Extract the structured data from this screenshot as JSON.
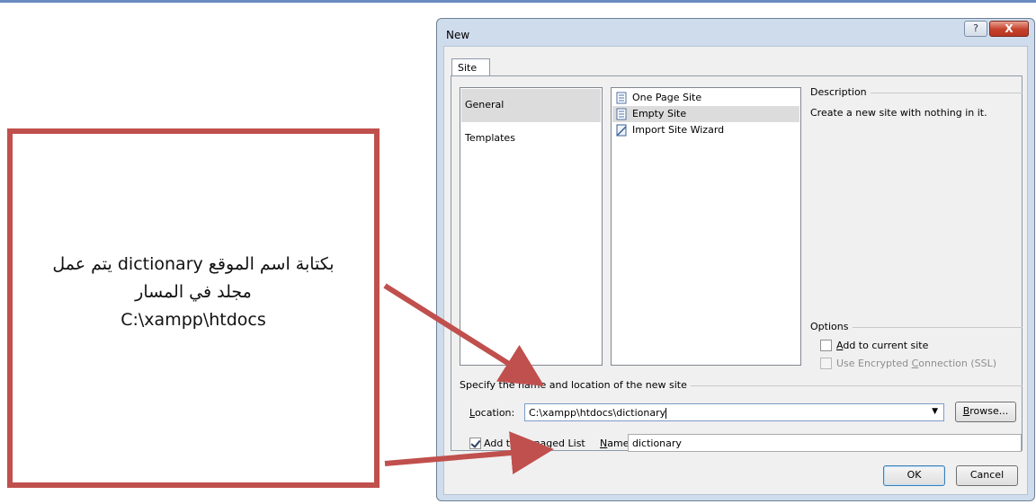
{
  "dialog": {
    "title": "New",
    "help_label": "?",
    "close_label": "X",
    "tab_label": "Site",
    "categories": [
      {
        "label": "General",
        "selected": true
      },
      {
        "label": "Templates",
        "selected": false
      }
    ],
    "templates": [
      {
        "label": "One Page Site",
        "icon": "page-icon",
        "selected": false
      },
      {
        "label": "Empty Site",
        "icon": "page-icon",
        "selected": true
      },
      {
        "label": "Import Site Wizard",
        "icon": "wizard-icon",
        "selected": false
      }
    ],
    "description_heading": "Description",
    "description_text": "Create a new site with nothing in it.",
    "options_heading": "Options",
    "options": [
      {
        "label_pre": "",
        "label_key": "A",
        "label_post": "dd to current site",
        "checked": false,
        "enabled": true
      },
      {
        "label_pre": "Use Encrypted ",
        "label_key": "C",
        "label_post": "onnection (SSL)",
        "checked": false,
        "enabled": false
      }
    ],
    "specify_heading": "Specify the name and location of the new site",
    "location_label_key": "L",
    "location_label_rest": "ocation:",
    "location_value": "C:\\xampp\\htdocs\\dictionary",
    "browse_key": "B",
    "browse_rest": "rowse...",
    "add_to_managed": {
      "label": "Add to Managed List",
      "checked": true
    },
    "name_label_key": "N",
    "name_label_rest": "ame:",
    "name_value": "dictionary",
    "ok_label": "OK",
    "cancel_label": "Cancel"
  },
  "annotation": {
    "line1": "بكتابة اسم الموقع dictionary يتم عمل",
    "line2": "مجلد في المسار",
    "line3": "C:\\xampp\\htdocs",
    "border_color": "#c0504d"
  }
}
